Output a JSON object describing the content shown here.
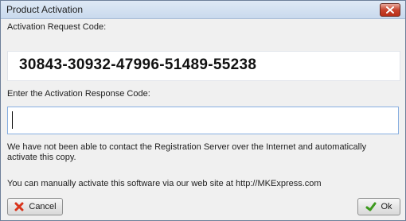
{
  "window": {
    "title": "Product Activation"
  },
  "request": {
    "label": "Activation Request Code:",
    "code": "30843-30932-47996-51489-55238"
  },
  "response": {
    "label": "Enter the Activation Response Code:",
    "value": ""
  },
  "message": {
    "text": "We have not been able to contact the Registration Server over the Internet and automatically activate this copy.",
    "manual": "You can manually activate this software via our web site at http://MKExpress.com"
  },
  "buttons": {
    "cancel": "Cancel",
    "ok": "Ok"
  },
  "colors": {
    "cancel_icon": "#d9341c",
    "ok_icon": "#3d9a1e",
    "close_button": "#c7432d"
  },
  "icons": {
    "close": "close-icon",
    "cancel": "x-icon",
    "ok": "checkmark-icon"
  }
}
